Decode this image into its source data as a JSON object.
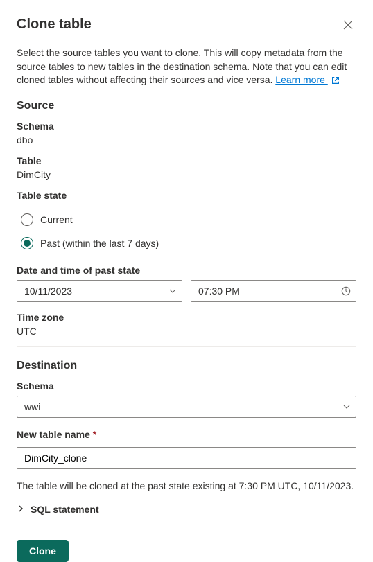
{
  "header": {
    "title": "Clone table",
    "closeIcon": "close-icon"
  },
  "description": {
    "text": "Select the source tables you want to clone. This will copy metadata from the source tables to new tables in the destination schema. Note that you can edit cloned tables without affecting their sources and vice versa. ",
    "learnMoreLabel": "Learn more "
  },
  "source": {
    "heading": "Source",
    "schemaLabel": "Schema",
    "schemaValue": "dbo",
    "tableLabel": "Table",
    "tableValue": "DimCity",
    "tableStateLabel": "Table state",
    "radioOptions": {
      "current": "Current",
      "past": "Past (within the last 7 days)"
    },
    "dateTimeLabel": "Date and time of past state",
    "dateValue": "10/11/2023",
    "timeValue": "07:30 PM",
    "timeZoneLabel": "Time zone",
    "timeZoneValue": "UTC"
  },
  "destination": {
    "heading": "Destination",
    "schemaLabel": "Schema",
    "schemaValue": "wwi",
    "newTableLabel": "New table name",
    "newTableValue": "DimCity_clone"
  },
  "summary": "The table will be cloned at the past state existing at 7:30 PM UTC, 10/11/2023.",
  "accordion": {
    "sqlStatementLabel": "SQL statement"
  },
  "actions": {
    "cloneLabel": "Clone"
  }
}
